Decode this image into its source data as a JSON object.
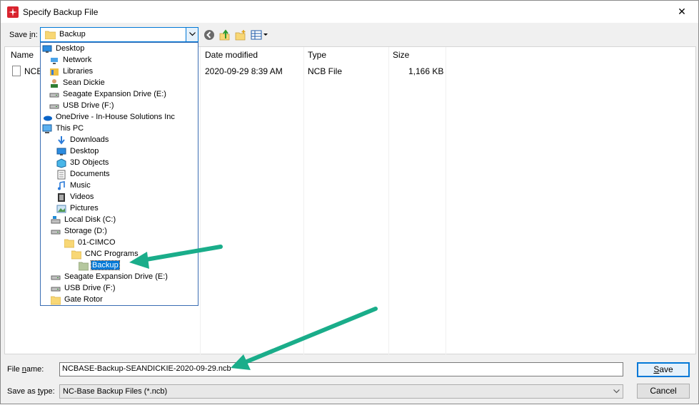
{
  "window": {
    "title": "Specify Backup File",
    "close_glyph": "✕"
  },
  "save_in": {
    "label_prefix": "Save ",
    "label_underline": "i",
    "label_suffix": "n:",
    "value": "Backup"
  },
  "columns": {
    "name": "Name",
    "date_modified": "Date modified",
    "type": "Type",
    "size": "Size"
  },
  "file": {
    "name_visible": "NCB",
    "date_modified": "2020-09-29 8:39 AM",
    "type": "NCB File",
    "size": "1,166 KB"
  },
  "tree": [
    {
      "label": "Desktop",
      "icon": "desktop-icon"
    },
    {
      "label": "Network",
      "icon": "network-icon"
    },
    {
      "label": "Libraries",
      "icon": "libraries-icon"
    },
    {
      "label": "Sean Dickie",
      "icon": "user-icon"
    },
    {
      "label": "Seagate Expansion Drive (E:)",
      "icon": "drive-icon"
    },
    {
      "label": "USB Drive (F:)",
      "icon": "drive-icon"
    },
    {
      "label": "OneDrive - In-House Solutions Inc",
      "icon": "onedrive-icon"
    },
    {
      "label": "This PC",
      "icon": "pc-icon"
    },
    {
      "label": "Downloads",
      "icon": "downloads-icon"
    },
    {
      "label": "Desktop",
      "icon": "desktop-icon"
    },
    {
      "label": "3D Objects",
      "icon": "objects-3d-icon"
    },
    {
      "label": "Documents",
      "icon": "documents-icon"
    },
    {
      "label": "Music",
      "icon": "music-icon"
    },
    {
      "label": "Videos",
      "icon": "videos-icon"
    },
    {
      "label": "Pictures",
      "icon": "pictures-icon"
    },
    {
      "label": "Local Disk (C:)",
      "icon": "local-disk-icon"
    },
    {
      "label": "Storage (D:)",
      "icon": "drive-icon"
    },
    {
      "label": "01-CIMCO",
      "icon": "folder-icon"
    },
    {
      "label": "CNC Programs",
      "icon": "folder-icon"
    },
    {
      "label": "Backup",
      "icon": "folder-open-icon"
    },
    {
      "label": "Seagate Expansion Drive (E:)",
      "icon": "drive-icon"
    },
    {
      "label": "USB Drive (F:)",
      "icon": "drive-icon"
    },
    {
      "label": "Gate Rotor",
      "icon": "folder-icon"
    }
  ],
  "file_name": {
    "label_prefix": "File ",
    "label_underline": "n",
    "label_suffix": "ame:",
    "value": "NCBASE-Backup-SEANDICKIE-2020-09-29.ncb"
  },
  "save_as_type": {
    "label_prefix": "Save as ",
    "label_underline": "t",
    "label_suffix": "ype:",
    "value": "NC-Base Backup Files (*.ncb)"
  },
  "buttons": {
    "save_underline": "S",
    "save_rest": "ave",
    "cancel": "Cancel"
  },
  "colors": {
    "accent": "#0078d7",
    "annotation_arrow": "#1aad8a",
    "selection": "#0078d7"
  }
}
